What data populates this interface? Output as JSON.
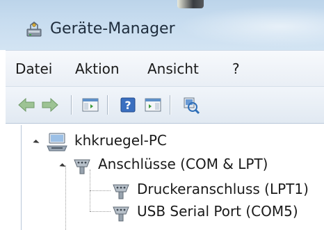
{
  "window": {
    "title": "Geräte-Manager",
    "icon": "device-manager-icon"
  },
  "menubar": {
    "items": [
      {
        "label": "Datei"
      },
      {
        "label": "Aktion"
      },
      {
        "label": "Ansicht"
      },
      {
        "label": "?"
      }
    ]
  },
  "toolbar": {
    "buttons": [
      {
        "icon": "back-arrow-icon"
      },
      {
        "icon": "forward-arrow-icon"
      },
      {
        "icon": "show-hide-console-tree-icon"
      },
      {
        "icon": "help-icon"
      },
      {
        "icon": "properties-pane-icon"
      },
      {
        "icon": "scan-hardware-changes-icon"
      }
    ]
  },
  "tree": {
    "root": {
      "label": "khkruegel-PC",
      "icon": "computer-icon",
      "expanded": true
    },
    "category": {
      "label": "Anschlüsse (COM & LPT)",
      "icon": "port-connector-icon",
      "expanded": true
    },
    "children": [
      {
        "label": "Druckeranschluss (LPT1)",
        "icon": "port-connector-icon"
      },
      {
        "label": "USB Serial Port (COM5)",
        "icon": "port-connector-icon"
      }
    ]
  },
  "colors": {
    "titlebar": "#c7dcef",
    "menubar": "#eef2f7",
    "toolbar": "#e6edf5",
    "text": "#1a1a1a",
    "arrow_green": "#4c9a3a"
  }
}
